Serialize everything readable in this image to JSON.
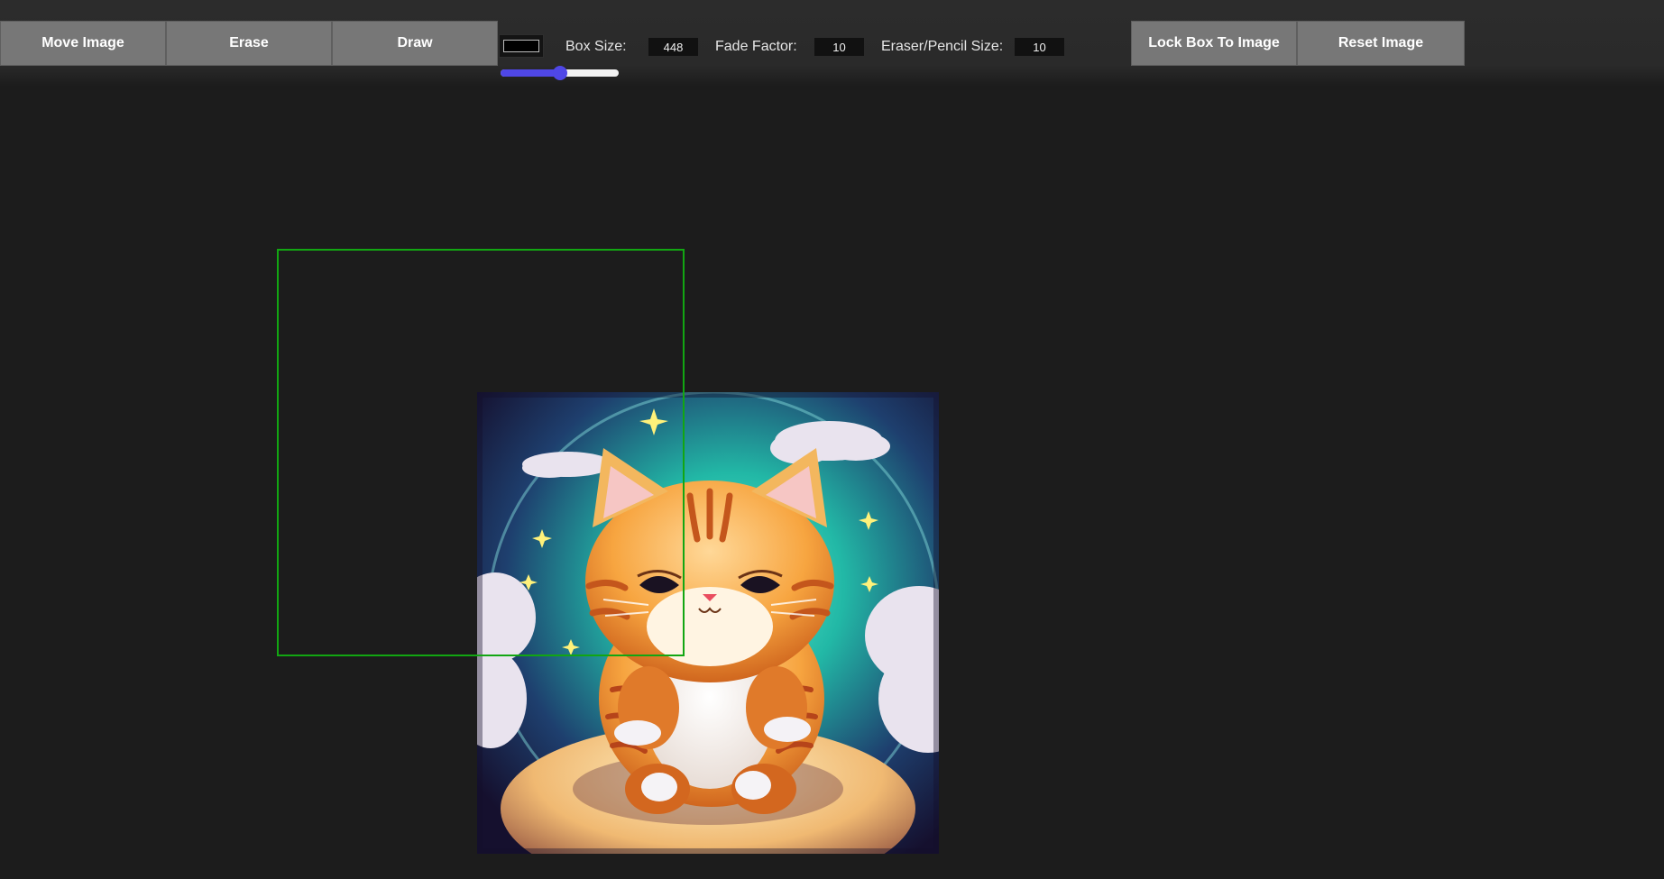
{
  "toolbar": {
    "move_label": "Move Image",
    "erase_label": "Erase",
    "draw_label": "Draw",
    "lock_label": "Lock Box To Image",
    "reset_label": "Reset Image",
    "color_value": "#000000",
    "box_size_label": "Box Size:",
    "box_size_value": "448",
    "fade_label": "Fade Factor:",
    "fade_value": "10",
    "eraser_label": "Eraser/Pencil Size:",
    "eraser_value": "10",
    "slider_fraction": 0.5
  },
  "colors": {
    "accent": "#4f47e6",
    "crop_box": "#12a612",
    "button_bg": "#777777",
    "background": "#1c1c1c"
  },
  "canvas": {
    "image_subject": "cartoon-orange-tabby-kitten-icon"
  }
}
